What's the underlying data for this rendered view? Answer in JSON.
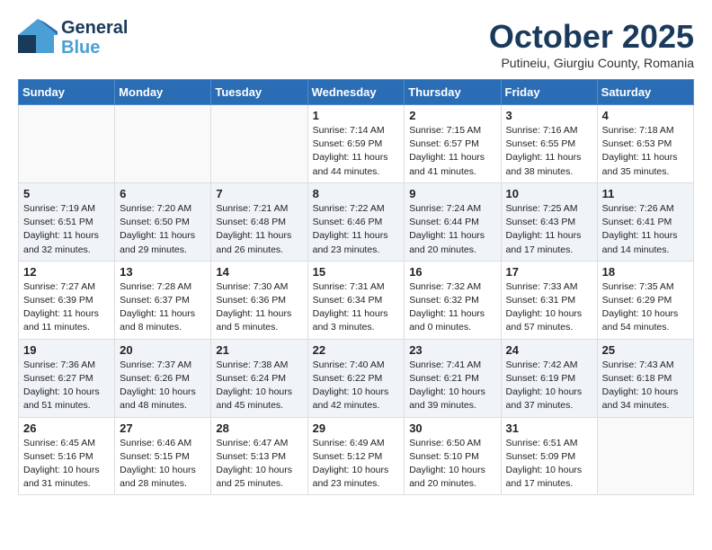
{
  "header": {
    "logo_line1": "General",
    "logo_line2": "Blue",
    "month": "October 2025",
    "location": "Putineiu, Giurgiu County, Romania"
  },
  "weekdays": [
    "Sunday",
    "Monday",
    "Tuesday",
    "Wednesday",
    "Thursday",
    "Friday",
    "Saturday"
  ],
  "weeks": [
    [
      {
        "day": "",
        "info": ""
      },
      {
        "day": "",
        "info": ""
      },
      {
        "day": "",
        "info": ""
      },
      {
        "day": "1",
        "info": "Sunrise: 7:14 AM\nSunset: 6:59 PM\nDaylight: 11 hours\nand 44 minutes."
      },
      {
        "day": "2",
        "info": "Sunrise: 7:15 AM\nSunset: 6:57 PM\nDaylight: 11 hours\nand 41 minutes."
      },
      {
        "day": "3",
        "info": "Sunrise: 7:16 AM\nSunset: 6:55 PM\nDaylight: 11 hours\nand 38 minutes."
      },
      {
        "day": "4",
        "info": "Sunrise: 7:18 AM\nSunset: 6:53 PM\nDaylight: 11 hours\nand 35 minutes."
      }
    ],
    [
      {
        "day": "5",
        "info": "Sunrise: 7:19 AM\nSunset: 6:51 PM\nDaylight: 11 hours\nand 32 minutes."
      },
      {
        "day": "6",
        "info": "Sunrise: 7:20 AM\nSunset: 6:50 PM\nDaylight: 11 hours\nand 29 minutes."
      },
      {
        "day": "7",
        "info": "Sunrise: 7:21 AM\nSunset: 6:48 PM\nDaylight: 11 hours\nand 26 minutes."
      },
      {
        "day": "8",
        "info": "Sunrise: 7:22 AM\nSunset: 6:46 PM\nDaylight: 11 hours\nand 23 minutes."
      },
      {
        "day": "9",
        "info": "Sunrise: 7:24 AM\nSunset: 6:44 PM\nDaylight: 11 hours\nand 20 minutes."
      },
      {
        "day": "10",
        "info": "Sunrise: 7:25 AM\nSunset: 6:43 PM\nDaylight: 11 hours\nand 17 minutes."
      },
      {
        "day": "11",
        "info": "Sunrise: 7:26 AM\nSunset: 6:41 PM\nDaylight: 11 hours\nand 14 minutes."
      }
    ],
    [
      {
        "day": "12",
        "info": "Sunrise: 7:27 AM\nSunset: 6:39 PM\nDaylight: 11 hours\nand 11 minutes."
      },
      {
        "day": "13",
        "info": "Sunrise: 7:28 AM\nSunset: 6:37 PM\nDaylight: 11 hours\nand 8 minutes."
      },
      {
        "day": "14",
        "info": "Sunrise: 7:30 AM\nSunset: 6:36 PM\nDaylight: 11 hours\nand 5 minutes."
      },
      {
        "day": "15",
        "info": "Sunrise: 7:31 AM\nSunset: 6:34 PM\nDaylight: 11 hours\nand 3 minutes."
      },
      {
        "day": "16",
        "info": "Sunrise: 7:32 AM\nSunset: 6:32 PM\nDaylight: 11 hours\nand 0 minutes."
      },
      {
        "day": "17",
        "info": "Sunrise: 7:33 AM\nSunset: 6:31 PM\nDaylight: 10 hours\nand 57 minutes."
      },
      {
        "day": "18",
        "info": "Sunrise: 7:35 AM\nSunset: 6:29 PM\nDaylight: 10 hours\nand 54 minutes."
      }
    ],
    [
      {
        "day": "19",
        "info": "Sunrise: 7:36 AM\nSunset: 6:27 PM\nDaylight: 10 hours\nand 51 minutes."
      },
      {
        "day": "20",
        "info": "Sunrise: 7:37 AM\nSunset: 6:26 PM\nDaylight: 10 hours\nand 48 minutes."
      },
      {
        "day": "21",
        "info": "Sunrise: 7:38 AM\nSunset: 6:24 PM\nDaylight: 10 hours\nand 45 minutes."
      },
      {
        "day": "22",
        "info": "Sunrise: 7:40 AM\nSunset: 6:22 PM\nDaylight: 10 hours\nand 42 minutes."
      },
      {
        "day": "23",
        "info": "Sunrise: 7:41 AM\nSunset: 6:21 PM\nDaylight: 10 hours\nand 39 minutes."
      },
      {
        "day": "24",
        "info": "Sunrise: 7:42 AM\nSunset: 6:19 PM\nDaylight: 10 hours\nand 37 minutes."
      },
      {
        "day": "25",
        "info": "Sunrise: 7:43 AM\nSunset: 6:18 PM\nDaylight: 10 hours\nand 34 minutes."
      }
    ],
    [
      {
        "day": "26",
        "info": "Sunrise: 6:45 AM\nSunset: 5:16 PM\nDaylight: 10 hours\nand 31 minutes."
      },
      {
        "day": "27",
        "info": "Sunrise: 6:46 AM\nSunset: 5:15 PM\nDaylight: 10 hours\nand 28 minutes."
      },
      {
        "day": "28",
        "info": "Sunrise: 6:47 AM\nSunset: 5:13 PM\nDaylight: 10 hours\nand 25 minutes."
      },
      {
        "day": "29",
        "info": "Sunrise: 6:49 AM\nSunset: 5:12 PM\nDaylight: 10 hours\nand 23 minutes."
      },
      {
        "day": "30",
        "info": "Sunrise: 6:50 AM\nSunset: 5:10 PM\nDaylight: 10 hours\nand 20 minutes."
      },
      {
        "day": "31",
        "info": "Sunrise: 6:51 AM\nSunset: 5:09 PM\nDaylight: 10 hours\nand 17 minutes."
      },
      {
        "day": "",
        "info": ""
      }
    ]
  ]
}
